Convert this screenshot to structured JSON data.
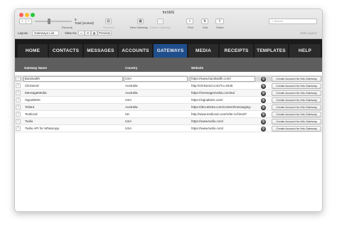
{
  "window": {
    "title": "fmSMS"
  },
  "toolbar": {
    "records_label": "Records",
    "record_number": "8",
    "record_total": "Total (Sorted)",
    "show_all": "Show All",
    "new_record": "New Gateway",
    "delete_record": "Delete Gateway",
    "find": "Find",
    "sort": "Sort",
    "share": "Share",
    "search_placeholder": "Search"
  },
  "layoutbar": {
    "layout_label": "Layout:",
    "layout_value": "Gateways List",
    "view_as_label": "View As:",
    "preview_label": "Preview",
    "edit_layout_label": "Edit Layout"
  },
  "menu": {
    "tabs": [
      {
        "label": "HOME"
      },
      {
        "label": "CONTACTS"
      },
      {
        "label": "MESSAGES"
      },
      {
        "label": "ACCOUNTS"
      },
      {
        "label": "GATEWAYS"
      },
      {
        "label": "MEDIA"
      },
      {
        "label": "RECEIPTS"
      },
      {
        "label": "TEMPLATES"
      },
      {
        "label": "HELP"
      }
    ],
    "active": "GATEWAYS"
  },
  "table": {
    "columns": [
      "Gateway Name",
      "Country",
      "Website"
    ],
    "button_label": "Create Account for this Gateway",
    "rows": [
      {
        "name": "Bandwidth",
        "country": "USA",
        "website": "https://www.bandwidth.com/"
      },
      {
        "name": "Clicksend",
        "country": "Australia",
        "website": "http://clicksend.com/?u=3445"
      },
      {
        "name": "MessageMedia",
        "country": "Australia",
        "website": "https://messagemedia.com/au/"
      },
      {
        "name": "SignalWire",
        "country": "USA",
        "website": "https://signalwire.com/"
      },
      {
        "name": "Telstra",
        "country": "Australia",
        "website": "https://dev.telstra.com/content/messaging-"
      },
      {
        "name": "Textlocal",
        "country": "UK",
        "website": "http://www.textlocal.com/refer-a-friend?"
      },
      {
        "name": "Twilio",
        "country": "USA",
        "website": "https://www.twilio.com/"
      },
      {
        "name": "Twilio API for WhatsApp",
        "country": "USA",
        "website": "https://www.twilio.com/"
      }
    ]
  },
  "colors": {
    "menu_bg": "#1a1a1a",
    "menu_active": "#1f4e8c",
    "header_bg": "#5e5e5e"
  },
  "icons": {
    "row_expand": "chevron-right-icon",
    "website": "globe-icon"
  }
}
